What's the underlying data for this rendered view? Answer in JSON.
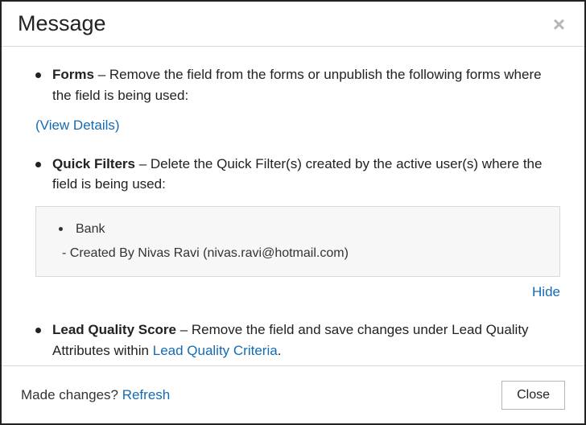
{
  "header": {
    "title": "Message",
    "close_icon": "×"
  },
  "items": {
    "forms": {
      "label": "Forms",
      "text": " – Remove the field from the forms or unpublish the following forms where the field is being used:",
      "view_details": "(View Details)"
    },
    "quick_filters": {
      "label": "Quick Filters",
      "text": " – Delete the Quick Filter(s) created by the active user(s) where the field is being used:",
      "detail_name": "Bank",
      "detail_by": "- Created By Nivas Ravi (nivas.ravi@hotmail.com)",
      "hide": "Hide"
    },
    "lead_quality": {
      "label": "Lead Quality Score",
      "text_before": " – Remove the field and save changes under Lead Quality Attributes within ",
      "link": "Lead Quality Criteria",
      "text_after": "."
    }
  },
  "footer": {
    "made_changes": "Made changes? ",
    "refresh": "Refresh",
    "close": "Close"
  }
}
